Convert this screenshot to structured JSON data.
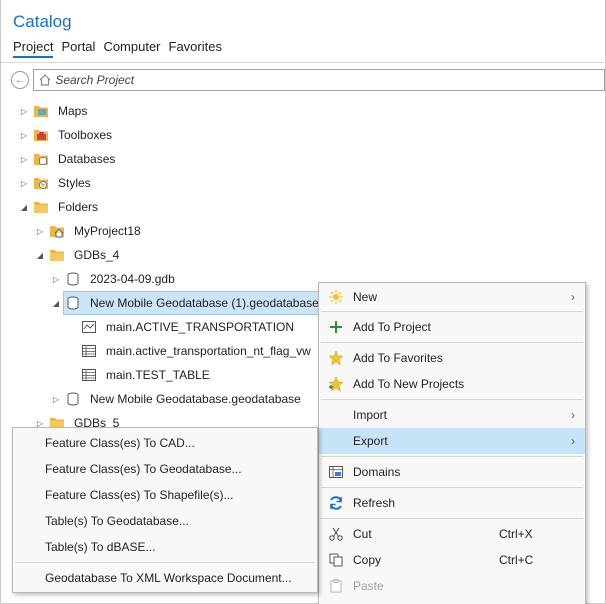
{
  "catalog": {
    "title": "Catalog",
    "tabs": [
      "Project",
      "Portal",
      "Computer",
      "Favorites"
    ],
    "search_placeholder": "Search Project"
  },
  "tree": [
    {
      "label": "Maps",
      "icon": "maps-folder-icon"
    },
    {
      "label": "Toolboxes",
      "icon": "toolbox-icon"
    },
    {
      "label": "Databases",
      "icon": "databases-folder-icon"
    },
    {
      "label": "Styles",
      "icon": "styles-folder-icon"
    },
    {
      "label": "Folders",
      "icon": "folder-icon"
    },
    {
      "label": "MyProject18",
      "icon": "home-folder-icon"
    },
    {
      "label": "GDBs_4",
      "icon": "folder-icon"
    },
    {
      "label": "2023-04-09.gdb",
      "icon": "geodatabase-icon"
    },
    {
      "label": "New Mobile Geodatabase (1).geodatabase",
      "icon": "mobile-geodatabase-icon"
    },
    {
      "label": "main.ACTIVE_TRANSPORTATION",
      "icon": "line-feature-class-icon"
    },
    {
      "label": "main.active_transportation_nt_flag_vw",
      "icon": "table-icon"
    },
    {
      "label": "main.TEST_TABLE",
      "icon": "table-icon"
    },
    {
      "label": "New Mobile Geodatabase.geodatabase",
      "icon": "mobile-geodatabase-icon"
    },
    {
      "label": "GDBs_5",
      "icon": "folder-icon"
    }
  ],
  "context_menu": {
    "new": "New",
    "add_to_project": "Add To Project",
    "add_to_favorites": "Add To Favorites",
    "add_to_new_projects": "Add To New Projects",
    "import": "Import",
    "export": "Export",
    "domains": "Domains",
    "refresh": "Refresh",
    "cut": "Cut",
    "cut_shortcut": "Ctrl+X",
    "copy": "Copy",
    "copy_shortcut": "Ctrl+C",
    "paste": "Paste"
  },
  "export_submenu": [
    "Feature Class(es) To CAD...",
    "Feature Class(es) To Geodatabase...",
    "Feature Class(es) To Shapefile(s)...",
    "Table(s) To Geodatabase...",
    "Table(s) To dBASE...",
    "Geodatabase To XML Workspace Document..."
  ],
  "colors": {
    "accent": "#1a6fc2",
    "selection": "#cce4f7",
    "folder": "#e8b64a"
  }
}
